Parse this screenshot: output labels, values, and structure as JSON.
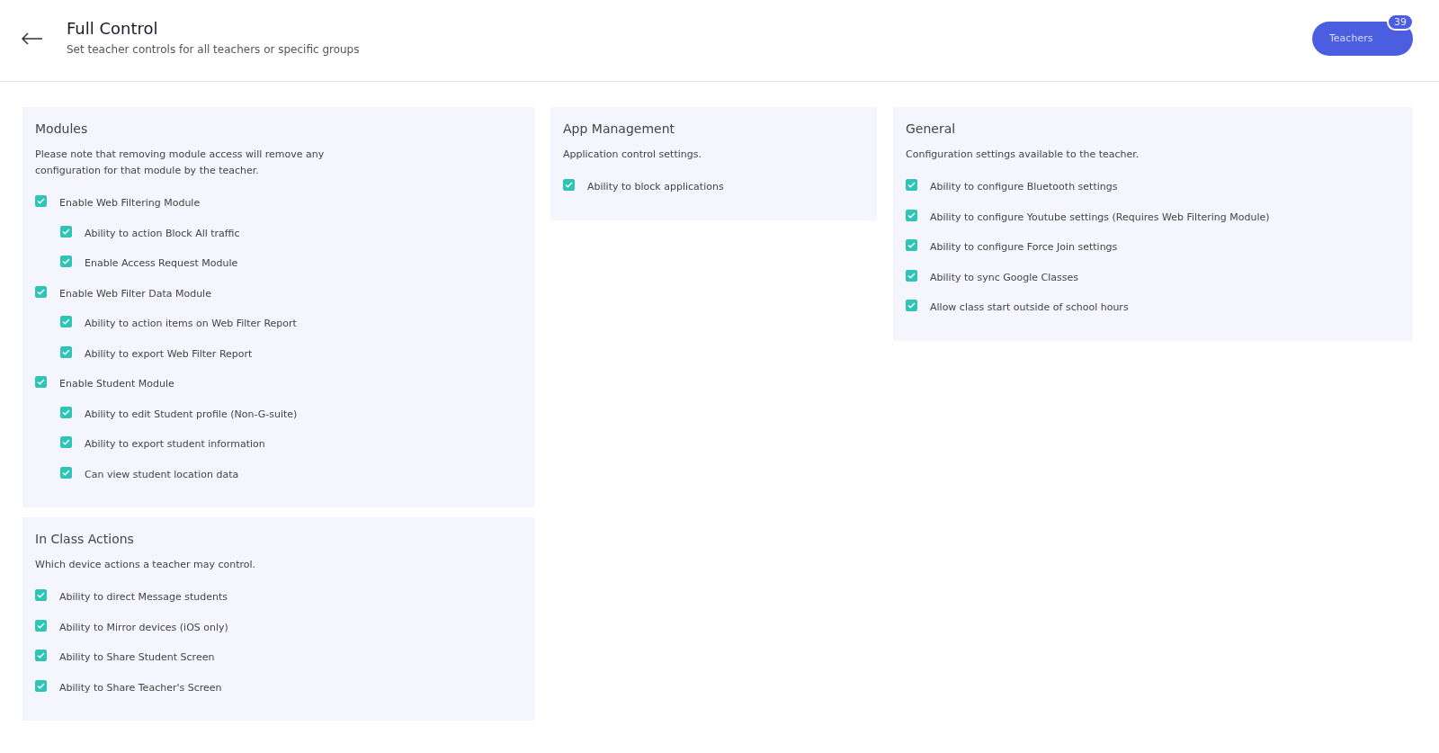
{
  "header": {
    "title": "Full Control",
    "subtitle": "Set teacher controls for all teachers or specific groups",
    "button": {
      "label": "Teachers",
      "badge": "39"
    }
  },
  "columns": [
    [
      {
        "title": "Modules",
        "description": "Please note that removing module access will remove any configuration for that module by the teacher.",
        "items": [
          {
            "label": "Enable Web Filtering Module",
            "checked": true,
            "children": [
              {
                "label": "Ability to action Block All traffic",
                "checked": true
              },
              {
                "label": "Enable Access Request Module",
                "checked": true
              }
            ]
          },
          {
            "label": "Enable Web Filter Data Module",
            "checked": true,
            "children": [
              {
                "label": "Ability to action items on Web Filter Report",
                "checked": true
              },
              {
                "label": "Ability to export Web Filter Report",
                "checked": true
              }
            ]
          },
          {
            "label": "Enable Student Module",
            "checked": true,
            "children": [
              {
                "label": "Ability to edit Student profile (Non-G-suite)",
                "checked": true
              },
              {
                "label": "Ability to export student information",
                "checked": true
              },
              {
                "label": "Can view student location data",
                "checked": true
              }
            ]
          }
        ]
      },
      {
        "title": "In Class Actions",
        "description": "Which device actions a teacher may control.",
        "items": [
          {
            "label": "Ability to direct Message students",
            "checked": true
          },
          {
            "label": "Ability to Mirror devices (iOS only)",
            "checked": true
          },
          {
            "label": "Ability to Share Student Screen",
            "checked": true
          },
          {
            "label": "Ability to Share Teacher's Screen",
            "checked": true
          }
        ]
      }
    ],
    [
      {
        "title": "App Management",
        "description": "Application control settings.",
        "items": [
          {
            "label": "Ability to block applications",
            "checked": true
          }
        ]
      }
    ],
    [
      {
        "title": "General",
        "description": "Configuration settings available to the teacher.",
        "items": [
          {
            "label": "Ability to configure Bluetooth settings",
            "checked": true
          },
          {
            "label": "Ability to configure Youtube settings (Requires Web Filtering Module)",
            "checked": true
          },
          {
            "label": "Ability to configure Force Join settings",
            "checked": true
          },
          {
            "label": "Ability to sync Google Classes",
            "checked": true
          },
          {
            "label": "Allow class start outside of school hours",
            "checked": true
          }
        ]
      }
    ]
  ]
}
